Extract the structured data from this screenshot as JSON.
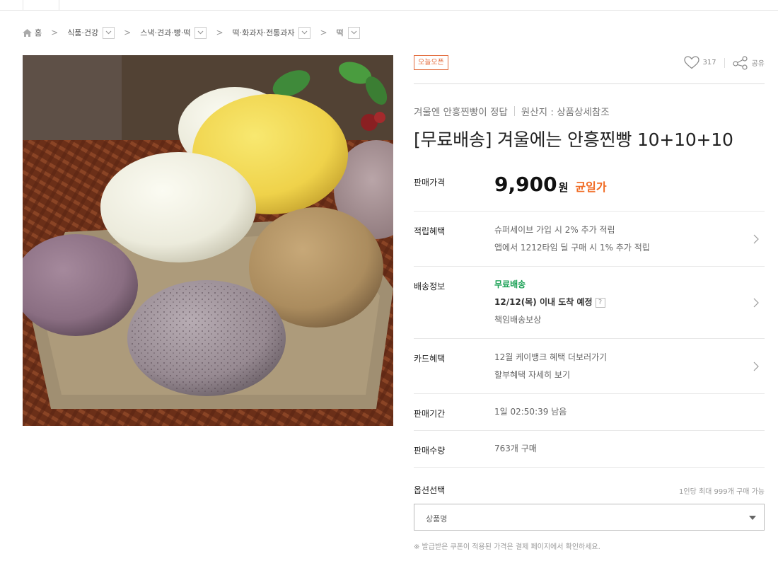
{
  "breadcrumb": {
    "home": "홈",
    "items": [
      "식품·건강",
      "스낵·견과·빵·떡",
      "떡·화과자·전통과자",
      "떡"
    ]
  },
  "product": {
    "badge": "오늘오픈",
    "likes": "317",
    "share_label": "공유",
    "subtitle": "겨울엔 안흥찐빵이 정답",
    "origin": "원산지 : 상품상세참조",
    "title": "[무료배송] 겨울에는 안흥찐빵 10+10+10"
  },
  "price_row": {
    "label": "판매가격",
    "price": "9,900",
    "unit": "원",
    "tag": "균일가"
  },
  "points_row": {
    "label": "적립혜택",
    "line1": "슈퍼세이브 가입 시 2% 추가 적립",
    "line2": "앱에서 1212타임 딜 구매 시 1% 추가 적립"
  },
  "delivery_row": {
    "label": "배송정보",
    "shipping": "무료배송",
    "eta": "12/12(목) 이내 도착 예정",
    "help": "?",
    "compensation": "책임배송보상"
  },
  "card_row": {
    "label": "카드혜택",
    "line1": "12월 케이뱅크 혜택 더보러가기",
    "line2": "할부혜택 자세히 보기"
  },
  "period_row": {
    "label": "판매기간",
    "value": "1일 02:50:39 남음"
  },
  "sold_row": {
    "label": "판매수량",
    "value": "763개 구매"
  },
  "options": {
    "label": "옵션선택",
    "limit": "1인당 최대 999개 구매 가능",
    "placeholder": "상품명",
    "note": "※ 발급받은 쿠폰이 적용된 가격은 결제 페이지에서 확인하세요."
  },
  "colors": {
    "accent": "#f06a22",
    "badge": "#e36b3c",
    "shipping": "#19a054"
  }
}
